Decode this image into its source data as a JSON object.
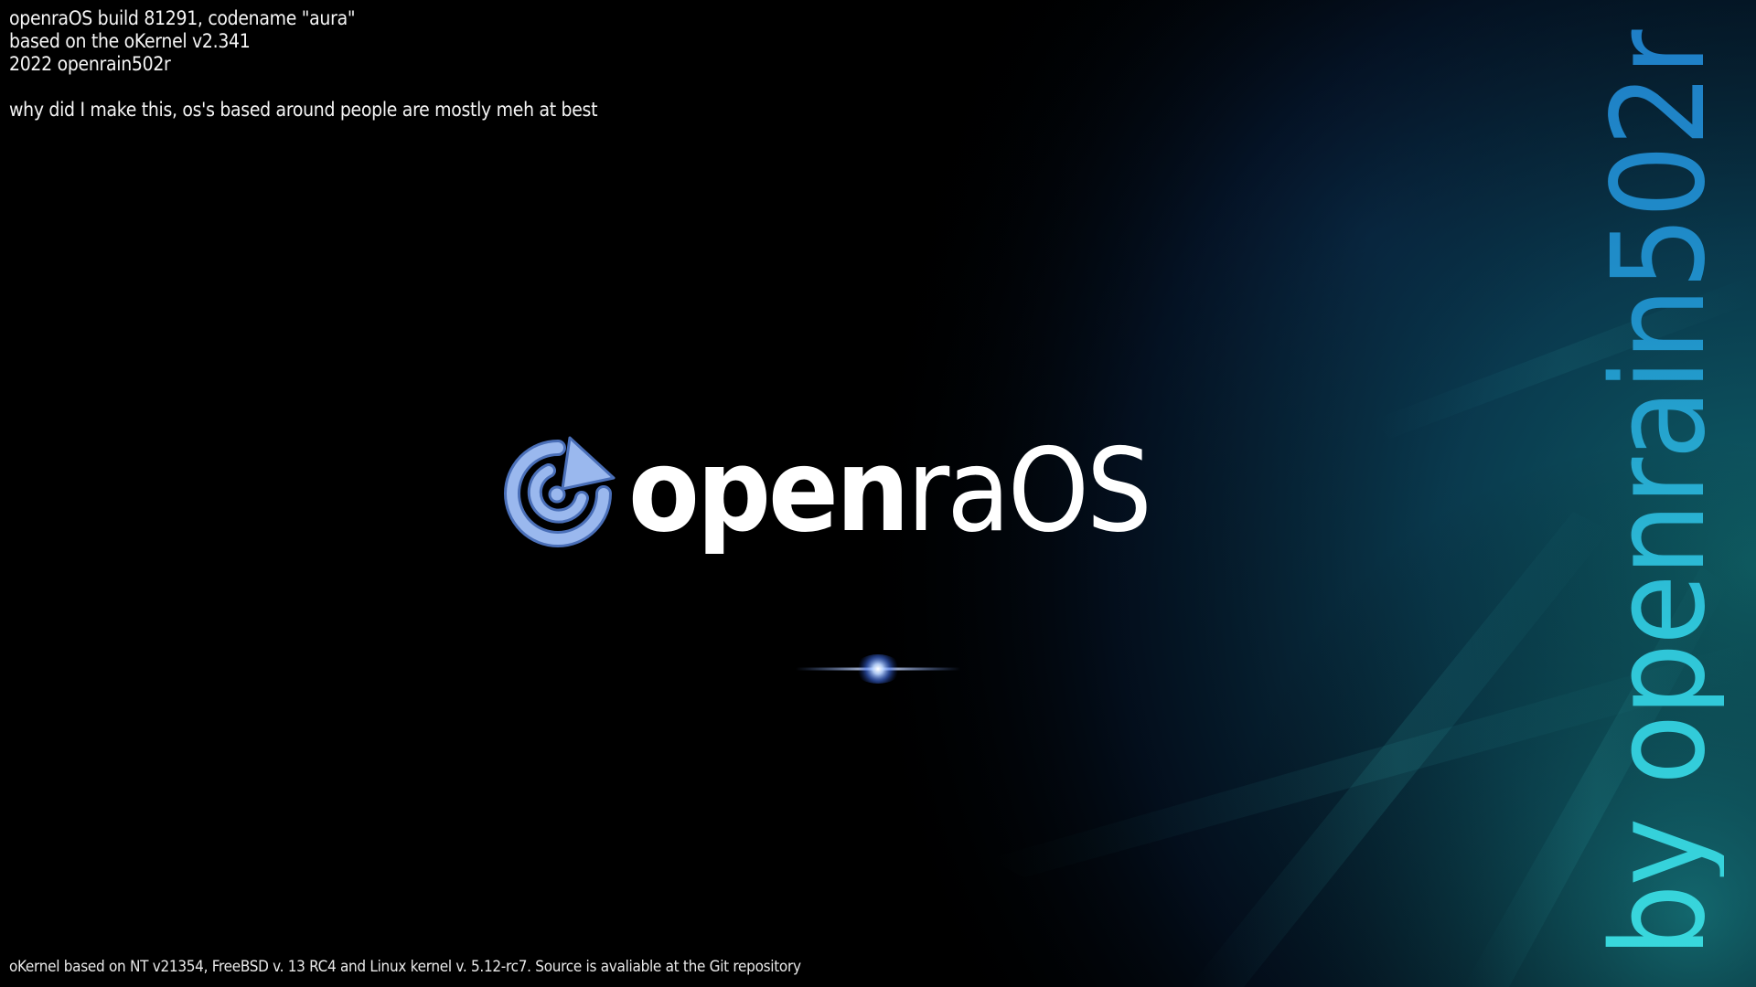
{
  "info": {
    "line1": "openraOS build 81291, codename \"aura\"",
    "line2": "based on the oKernel v2.341",
    "line3": "2022 openrain502r",
    "line4": "why did I make this, os's based around people are mostly meh at best"
  },
  "logo": {
    "bold_part": "open",
    "light_part": "raOS",
    "icon": "openraos-power-arrow-icon"
  },
  "loading": {
    "indicator": "loading-flare-icon"
  },
  "vertical_credit": "by openrain502r",
  "footer": "oKernel based on NT v21354, FreeBSD v. 13 RC4 and Linux kernel v. 5.12-rc7. Source is avaliable at the Git repository",
  "colors": {
    "background": "#000000",
    "accent_icon": "#8fb0ea",
    "credit_gradient_start": "#1f7fc7",
    "credit_gradient_end": "#39d8dc"
  }
}
